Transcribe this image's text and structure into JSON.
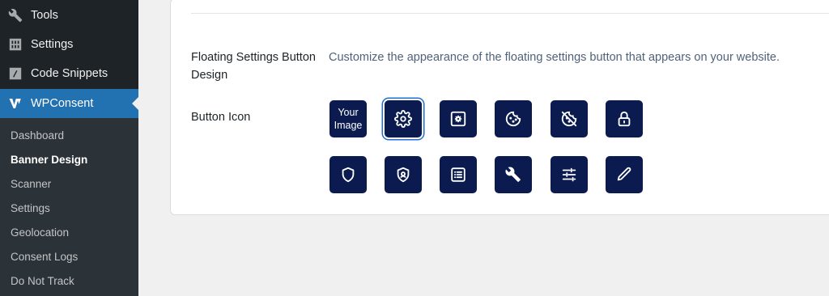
{
  "sidebar": {
    "menu": [
      {
        "label": "Tools",
        "icon": "wrench-icon"
      },
      {
        "label": "Settings",
        "icon": "settings-sliders-icon"
      },
      {
        "label": "Code Snippets",
        "icon": "code-icon"
      },
      {
        "label": "WPConsent",
        "icon": "wpconsent-logo-icon",
        "active": true
      }
    ],
    "submenu": [
      {
        "label": "Dashboard"
      },
      {
        "label": "Banner Design",
        "current": true
      },
      {
        "label": "Scanner"
      },
      {
        "label": "Settings"
      },
      {
        "label": "Geolocation"
      },
      {
        "label": "Consent Logs"
      },
      {
        "label": "Do Not Track"
      }
    ]
  },
  "floating": {
    "label_line1": "Floating Settings Button",
    "label_line2": "Design",
    "description": "Customize the appearance of the floating settings button that appears on your website."
  },
  "button_icon": {
    "label": "Button Icon",
    "your_image_line1": "Your",
    "your_image_line2": "Image",
    "selected": "gear-icon",
    "icons_row1": [
      "your-image",
      "gear-icon",
      "gear-square-icon",
      "cookie-icon",
      "cookie-slash-icon",
      "lock-icon"
    ],
    "icons_row2": [
      "shield-icon",
      "shield-user-icon",
      "list-icon",
      "wrench-icon",
      "sliders-icon",
      "pencil-icon"
    ],
    "colors": {
      "button_bg": "#0b1b4f",
      "selected_ring": "#1f6fd1"
    }
  },
  "colors": {
    "sidebar_bg": "#1d2327",
    "submenu_bg": "#2c3338",
    "active_bg": "#2271b1"
  }
}
